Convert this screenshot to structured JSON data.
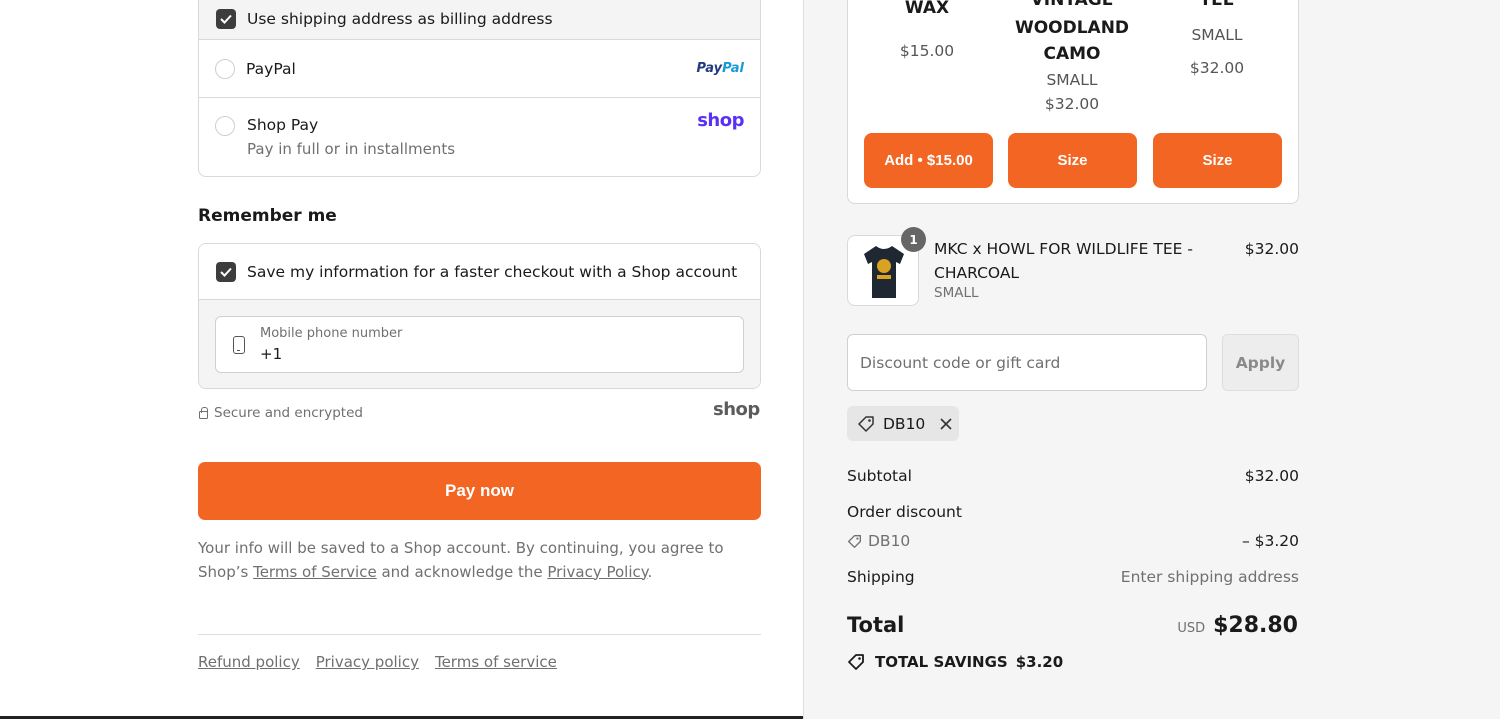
{
  "payment": {
    "billing_label": "Use shipping address as billing address",
    "paypal_label": "PayPal",
    "paypal_logo_a": "Pay",
    "paypal_logo_b": "Pal",
    "shoppay_label": "Shop Pay",
    "shoppay_sub": "Pay in full or in installments",
    "shop_logo": "shop"
  },
  "remember": {
    "title": "Remember me",
    "save_label": "Save my information for a faster checkout with a Shop account",
    "phone_label": "Mobile phone number",
    "phone_value": "+1",
    "secure_text": "Secure and encrypted",
    "shop_logo": "shop"
  },
  "pay_now": "Pay now",
  "terms": {
    "text_1": "Your info will be saved to a Shop account. By continuing, you agree to Shop’s",
    "tos_link": "Terms of Service",
    "text_2": "and acknowledge the",
    "privacy_link": "Privacy Policy",
    "text_3": "."
  },
  "footer": {
    "refund": "Refund policy",
    "privacy": "Privacy policy",
    "terms": "Terms of service"
  },
  "upsell": {
    "items": [
      {
        "name": "WAX",
        "price": "$15.00",
        "button": "Add • $15.00"
      },
      {
        "name_1": "VINTAGE",
        "name_2": "WOODLAND",
        "name_3": "CAMO",
        "variant": "SMALL",
        "price": "$32.00",
        "button": "Size"
      },
      {
        "name": "TEE",
        "variant": "SMALL",
        "price": "$32.00",
        "button": "Size"
      }
    ]
  },
  "cart": {
    "quantity": "1",
    "product_name": "MKC x HOWL FOR WILDLIFE TEE - CHARCOAL",
    "variant": "SMALL",
    "price": "$32.00"
  },
  "discount": {
    "placeholder": "Discount code or gift card",
    "apply": "Apply",
    "applied_code": "DB10"
  },
  "summary": {
    "subtotal_label": "Subtotal",
    "subtotal_value": "$32.00",
    "order_discount_label": "Order discount",
    "discount_code": "DB10",
    "discount_value": "– $3.20",
    "shipping_label": "Shipping",
    "shipping_value": "Enter shipping address",
    "total_label": "Total",
    "currency": "USD",
    "total_value": "$28.80",
    "savings_label": "TOTAL SAVINGS",
    "savings_value": "$3.20"
  },
  "colors": {
    "accent": "#f26522",
    "shop_purple": "#5a31f4"
  }
}
